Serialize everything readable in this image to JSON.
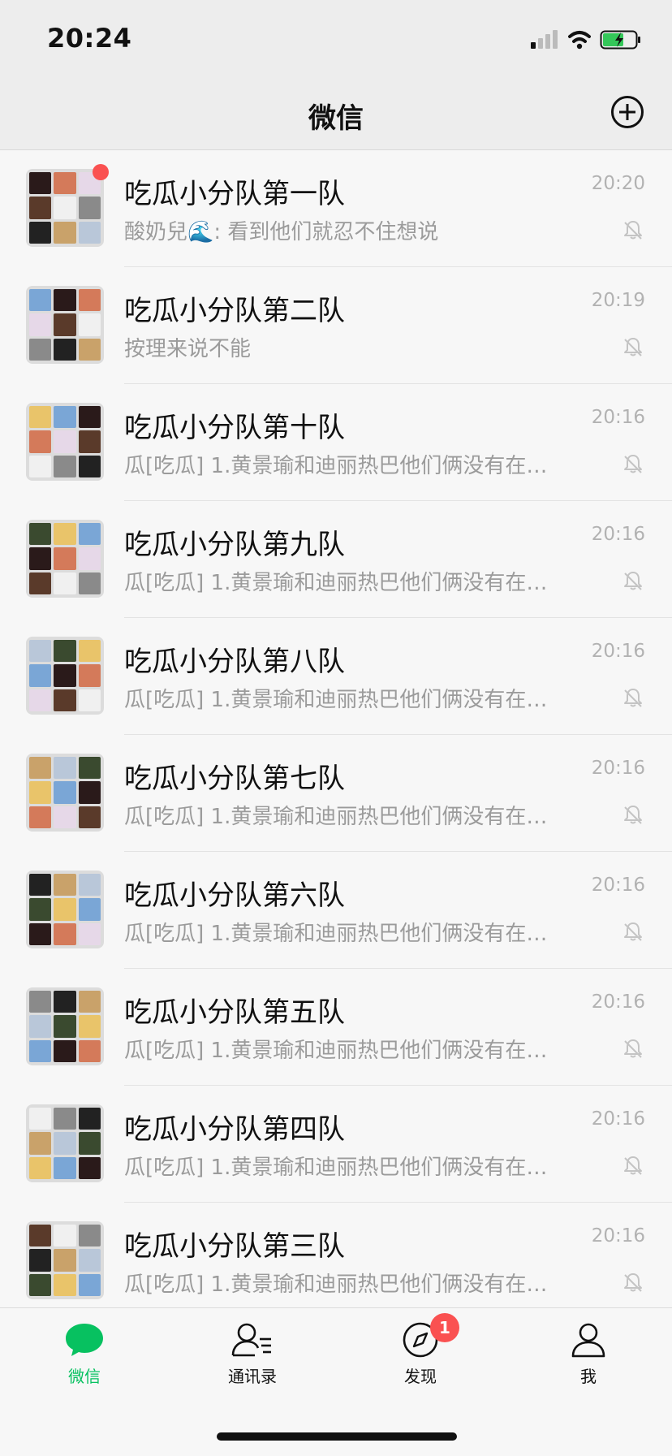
{
  "status_bar": {
    "time": "20:24",
    "icons": [
      "signal-icon",
      "wifi-icon",
      "battery-charging-icon"
    ]
  },
  "header": {
    "title": "微信",
    "add_icon": "plus-circle-icon"
  },
  "chats": [
    {
      "name": "吃瓜小分队第一队",
      "preview": "酸奶兒🌊: 看到他们就忍不住想说",
      "time": "20:20",
      "muted": true,
      "unread_dot": true
    },
    {
      "name": "吃瓜小分队第二队",
      "preview": "按理来说不能",
      "time": "20:19",
      "muted": true,
      "unread_dot": false
    },
    {
      "name": "吃瓜小分队第十队",
      "preview": "瓜[吃瓜] 1.黄景瑜和迪丽热巴他们俩没有在…",
      "time": "20:16",
      "muted": true,
      "unread_dot": false
    },
    {
      "name": "吃瓜小分队第九队",
      "preview": "瓜[吃瓜] 1.黄景瑜和迪丽热巴他们俩没有在…",
      "time": "20:16",
      "muted": true,
      "unread_dot": false
    },
    {
      "name": "吃瓜小分队第八队",
      "preview": "瓜[吃瓜] 1.黄景瑜和迪丽热巴他们俩没有在…",
      "time": "20:16",
      "muted": true,
      "unread_dot": false
    },
    {
      "name": "吃瓜小分队第七队",
      "preview": "瓜[吃瓜] 1.黄景瑜和迪丽热巴他们俩没有在…",
      "time": "20:16",
      "muted": true,
      "unread_dot": false
    },
    {
      "name": "吃瓜小分队第六队",
      "preview": "瓜[吃瓜] 1.黄景瑜和迪丽热巴他们俩没有在…",
      "time": "20:16",
      "muted": true,
      "unread_dot": false
    },
    {
      "name": "吃瓜小分队第五队",
      "preview": "瓜[吃瓜] 1.黄景瑜和迪丽热巴他们俩没有在…",
      "time": "20:16",
      "muted": true,
      "unread_dot": false
    },
    {
      "name": "吃瓜小分队第四队",
      "preview": "瓜[吃瓜] 1.黄景瑜和迪丽热巴他们俩没有在…",
      "time": "20:16",
      "muted": true,
      "unread_dot": false
    },
    {
      "name": "吃瓜小分队第三队",
      "preview": "瓜[吃瓜] 1.黄景瑜和迪丽热巴他们俩没有在…",
      "time": "20:16",
      "muted": true,
      "unread_dot": false
    }
  ],
  "tab_bar": {
    "tabs": [
      {
        "label": "微信",
        "icon": "chat-bubble-icon",
        "active": true
      },
      {
        "label": "通讯录",
        "icon": "contacts-icon",
        "active": false
      },
      {
        "label": "发现",
        "icon": "compass-icon",
        "active": false,
        "badge": "1"
      },
      {
        "label": "我",
        "icon": "person-icon",
        "active": false
      }
    ]
  },
  "colors": {
    "accent": "#07c160",
    "badge": "#fa5151",
    "background": "#ededed",
    "list_background": "#f7f7f7",
    "secondary_text": "#9b9b9b"
  }
}
